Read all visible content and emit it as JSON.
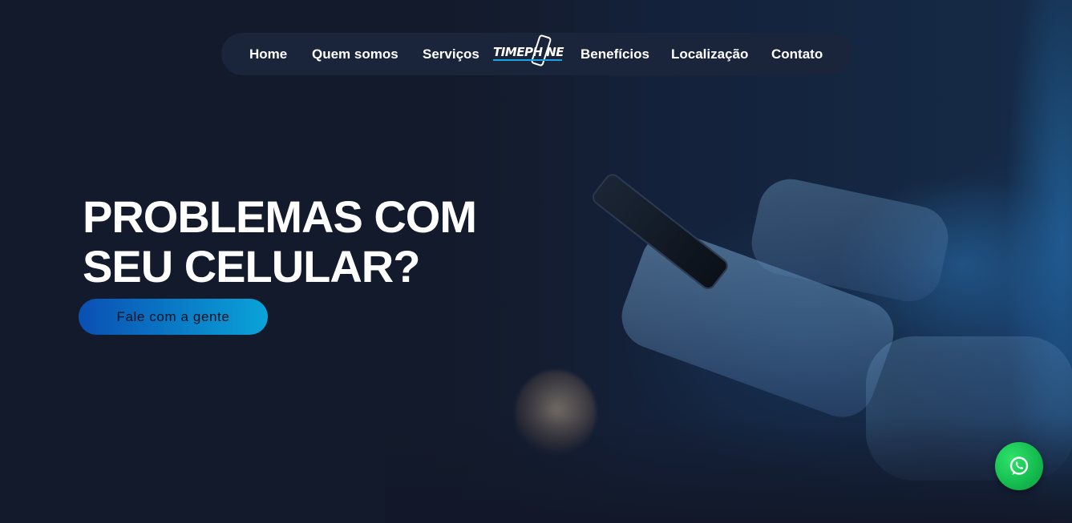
{
  "nav": {
    "links_left": [
      {
        "label": "Home"
      },
      {
        "label": "Quem somos"
      },
      {
        "label": "Serviços"
      }
    ],
    "logo": {
      "text": "TIMEPH NE",
      "icon": "phone-logo-icon"
    },
    "links_right": [
      {
        "label": "Benefícios"
      },
      {
        "label": "Localização"
      },
      {
        "label": "Contato"
      }
    ]
  },
  "hero": {
    "headline_line1": "PROBLEMAS COM",
    "headline_line2": "SEU CELULAR?",
    "cta_label": "Fale com a gente",
    "background_image": "hands-holding-smartphone-photo"
  },
  "floating": {
    "whatsapp_icon": "whatsapp-icon",
    "whatsapp_color": "#25D366"
  },
  "colors": {
    "background": "#131a2b",
    "nav_background": "#1a243a",
    "accent_start": "#0a4fb3",
    "accent_end": "#0aa3d8"
  }
}
